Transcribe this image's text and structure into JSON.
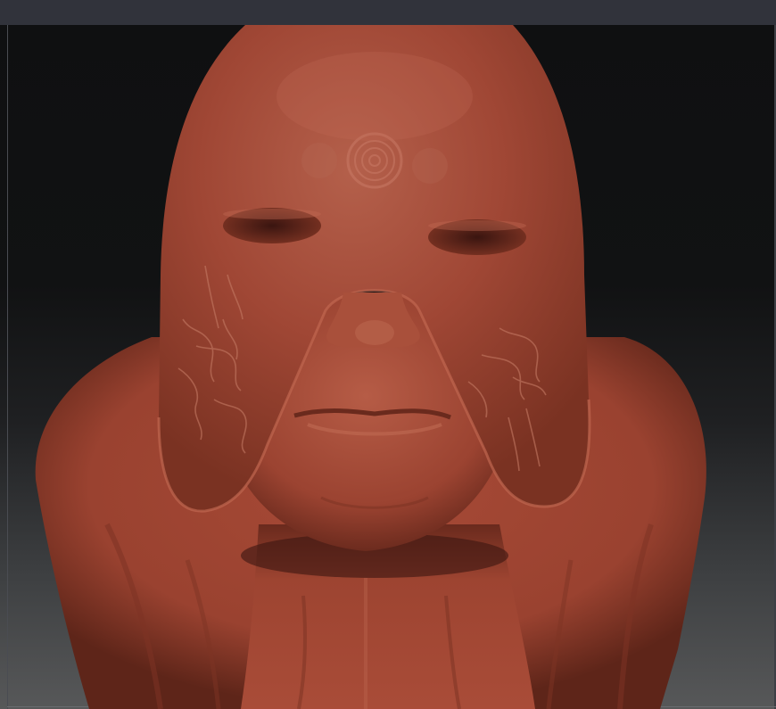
{
  "app": {
    "window_title": ""
  },
  "viewport": {
    "model": "sculpted-head-with-mask",
    "material_color": "#a0432f",
    "background_top": "#0f1011",
    "background_bottom": "#575859"
  },
  "icons": {
    "model": "sculpt-model-icon"
  }
}
